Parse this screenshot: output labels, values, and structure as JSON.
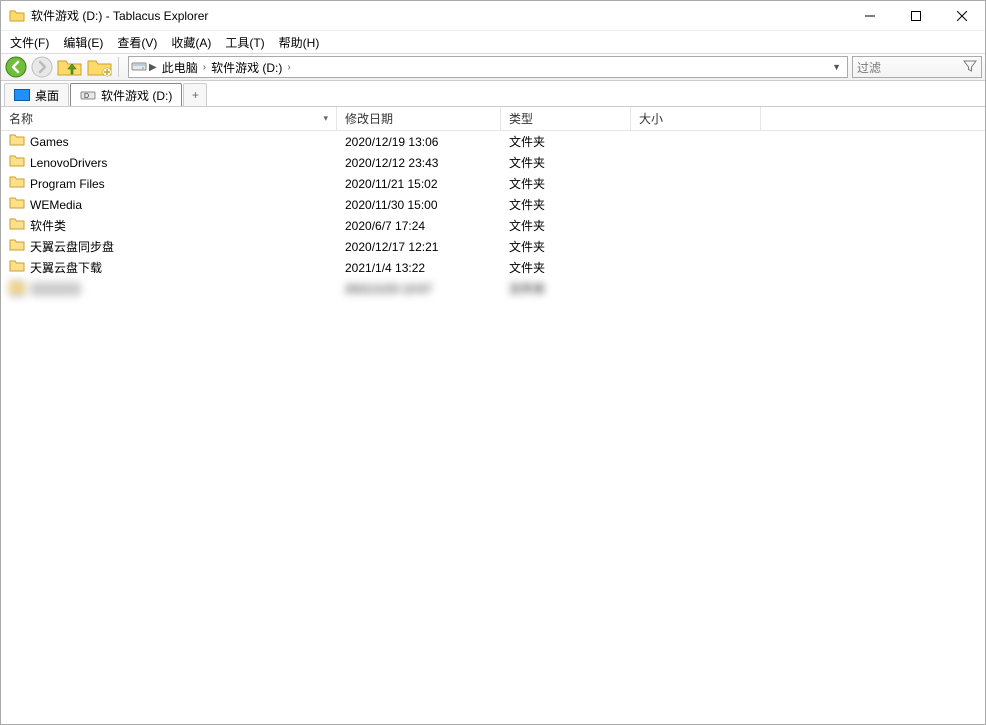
{
  "window": {
    "title": "软件游戏 (D:) - Tablacus Explorer"
  },
  "menu": {
    "file": "文件(F)",
    "edit": "编辑(E)",
    "view": "查看(V)",
    "favorites": "收藏(A)",
    "tools": "工具(T)",
    "help": "帮助(H)"
  },
  "address": {
    "root": "此电脑",
    "drive": "软件游戏 (D:)"
  },
  "filter": {
    "placeholder": "过滤"
  },
  "tabs": {
    "t0": {
      "label": "桌面"
    },
    "t1": {
      "label": "软件游戏 (D:)"
    },
    "newtab": "+"
  },
  "columns": {
    "name": "名称",
    "date": "修改日期",
    "type": "类型",
    "size": "大小"
  },
  "rows": [
    {
      "name": "Games",
      "date": "2020/12/19 13:06",
      "type": "文件夹",
      "size": ""
    },
    {
      "name": "LenovoDrivers",
      "date": "2020/12/12 23:43",
      "type": "文件夹",
      "size": ""
    },
    {
      "name": "Program Files",
      "date": "2020/11/21 15:02",
      "type": "文件夹",
      "size": ""
    },
    {
      "name": "WEMedia",
      "date": "2020/11/30 15:00",
      "type": "文件夹",
      "size": ""
    },
    {
      "name": "软件类",
      "date": "2020/6/7 17:24",
      "type": "文件夹",
      "size": ""
    },
    {
      "name": "天翼云盘同步盘",
      "date": "2020/12/17 12:21",
      "type": "文件夹",
      "size": ""
    },
    {
      "name": "天翼云盘下载",
      "date": "2021/1/4 13:22",
      "type": "文件夹",
      "size": ""
    },
    {
      "name": "██████",
      "date": "2021/1/23 13:57",
      "type": "文件夹",
      "size": "",
      "blurred": true
    }
  ]
}
